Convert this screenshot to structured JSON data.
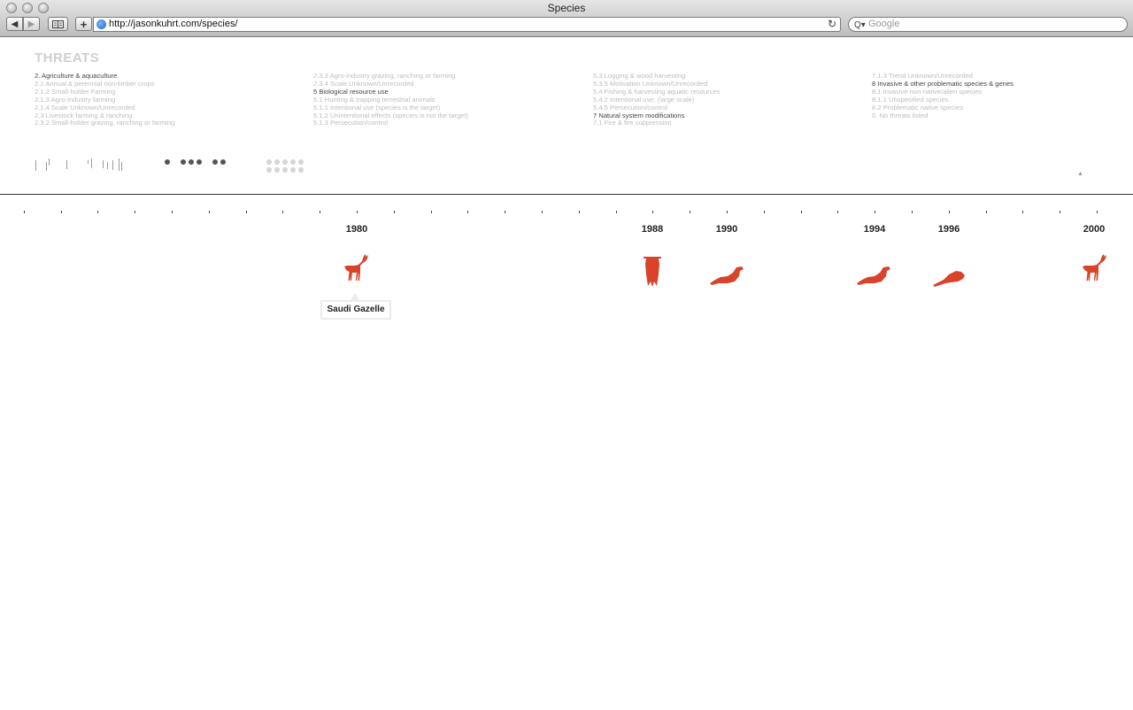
{
  "window": {
    "title": "Species"
  },
  "toolbar": {
    "back": "◀",
    "forward": "▶",
    "add": "+",
    "url": "http://jasonkuhrt.com/species/",
    "search_placeholder": "Google",
    "reload": "↻",
    "search_glyph": "Q▾"
  },
  "threats": {
    "heading": "THREATS",
    "columns": [
      [
        {
          "label": "2. Agriculture & aquaculture",
          "active": true
        },
        {
          "label": "2.1 Annual & perennial non-timber crops",
          "active": false
        },
        {
          "label": "2.1.2 Small-holder Farming",
          "active": false
        },
        {
          "label": "2.1.3 Agro-industry farming",
          "active": false
        },
        {
          "label": "2.1.4 Scale Unknown/Unrecorded",
          "active": false
        },
        {
          "label": "2.3 Livestock farming & ranching",
          "active": false
        },
        {
          "label": "2.3.2 Small-holder grazing, ranching or farming",
          "active": false
        }
      ],
      [
        {
          "label": "2.3.3 Agro-industry grazing, ranching or farming",
          "active": false
        },
        {
          "label": "2.3.4 Scale Unknown/Unrecorded",
          "active": false
        },
        {
          "label": "5 Biological resource use",
          "active": true
        },
        {
          "label": "5.1 Hunting & trapping terrestrial animals",
          "active": false
        },
        {
          "label": "5.1.1 Intentional use (species is the target)",
          "active": false
        },
        {
          "label": "5.1.2 Unintentional effects (species is not the target)",
          "active": false
        },
        {
          "label": "5.1.3 Persecution/control",
          "active": false
        }
      ],
      [
        {
          "label": "5.3 Logging & wood harvesting",
          "active": false
        },
        {
          "label": "5.3.5 Motivation Unknown/Unrecorded",
          "active": false
        },
        {
          "label": "5.4 Fishing & harvesting aquatic resources",
          "active": false
        },
        {
          "label": "5.4.2 Intentional use: (large scale)",
          "active": false
        },
        {
          "label": "5.4.5 Persecution/control",
          "active": false
        },
        {
          "label": "7 Natural system modifications",
          "active": true
        },
        {
          "label": "7.1 Fire & fire suppression",
          "active": false
        }
      ],
      [
        {
          "label": "7.1.3 Trend Unknown/Unrecorded",
          "active": false
        },
        {
          "label": "8 Invasive & other problematic species & genes",
          "active": true
        },
        {
          "label": "8.1 Invasive non-native/alien species",
          "active": false
        },
        {
          "label": "8.1.1 Unspecified species",
          "active": false
        },
        {
          "label": "8.2 Problematic native species",
          "active": false
        },
        {
          "label": "0. No threats listed",
          "active": false
        }
      ]
    ]
  },
  "timeline": {
    "years": [
      {
        "label": "1980",
        "year": 1980
      },
      {
        "label": "1988",
        "year": 1988
      },
      {
        "label": "1990",
        "year": 1990
      },
      {
        "label": "1994",
        "year": 1994
      },
      {
        "label": "1996",
        "year": 1996
      },
      {
        "label": "2000",
        "year": 2000
      }
    ],
    "species": [
      {
        "year": 1980,
        "icon": "gazelle-icon"
      },
      {
        "year": 1988,
        "icon": "bat-icon"
      },
      {
        "year": 1990,
        "icon": "seal-icon"
      },
      {
        "year": 1994,
        "icon": "seal-icon"
      },
      {
        "year": 1996,
        "icon": "rodent-icon"
      },
      {
        "year": 2000,
        "icon": "gazelle-icon"
      }
    ],
    "tooltip": "Saudi Gazelle",
    "accent_color": "#d8432a"
  }
}
